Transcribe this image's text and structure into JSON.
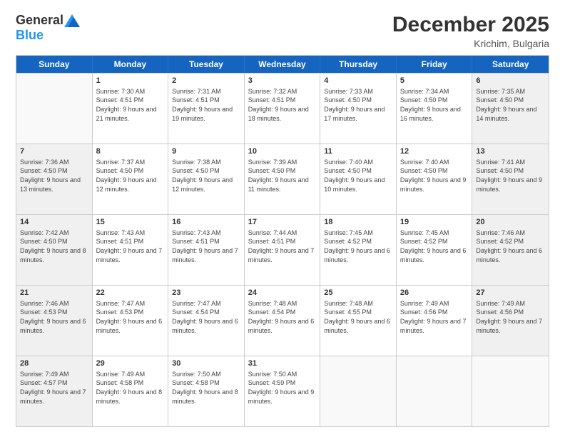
{
  "header": {
    "logo_general": "General",
    "logo_blue": "Blue",
    "month_title": "December 2025",
    "location": "Krichim, Bulgaria"
  },
  "days_of_week": [
    "Sunday",
    "Monday",
    "Tuesday",
    "Wednesday",
    "Thursday",
    "Friday",
    "Saturday"
  ],
  "rows": [
    [
      {
        "day": "",
        "empty": true
      },
      {
        "day": "1",
        "sunrise": "Sunrise: 7:30 AM",
        "sunset": "Sunset: 4:51 PM",
        "daylight": "Daylight: 9 hours and 21 minutes."
      },
      {
        "day": "2",
        "sunrise": "Sunrise: 7:31 AM",
        "sunset": "Sunset: 4:51 PM",
        "daylight": "Daylight: 9 hours and 19 minutes."
      },
      {
        "day": "3",
        "sunrise": "Sunrise: 7:32 AM",
        "sunset": "Sunset: 4:51 PM",
        "daylight": "Daylight: 9 hours and 18 minutes."
      },
      {
        "day": "4",
        "sunrise": "Sunrise: 7:33 AM",
        "sunset": "Sunset: 4:50 PM",
        "daylight": "Daylight: 9 hours and 17 minutes."
      },
      {
        "day": "5",
        "sunrise": "Sunrise: 7:34 AM",
        "sunset": "Sunset: 4:50 PM",
        "daylight": "Daylight: 9 hours and 16 minutes."
      },
      {
        "day": "6",
        "sunrise": "Sunrise: 7:35 AM",
        "sunset": "Sunset: 4:50 PM",
        "daylight": "Daylight: 9 hours and 14 minutes."
      }
    ],
    [
      {
        "day": "7",
        "sunrise": "Sunrise: 7:36 AM",
        "sunset": "Sunset: 4:50 PM",
        "daylight": "Daylight: 9 hours and 13 minutes."
      },
      {
        "day": "8",
        "sunrise": "Sunrise: 7:37 AM",
        "sunset": "Sunset: 4:50 PM",
        "daylight": "Daylight: 9 hours and 12 minutes."
      },
      {
        "day": "9",
        "sunrise": "Sunrise: 7:38 AM",
        "sunset": "Sunset: 4:50 PM",
        "daylight": "Daylight: 9 hours and 12 minutes."
      },
      {
        "day": "10",
        "sunrise": "Sunrise: 7:39 AM",
        "sunset": "Sunset: 4:50 PM",
        "daylight": "Daylight: 9 hours and 11 minutes."
      },
      {
        "day": "11",
        "sunrise": "Sunrise: 7:40 AM",
        "sunset": "Sunset: 4:50 PM",
        "daylight": "Daylight: 9 hours and 10 minutes."
      },
      {
        "day": "12",
        "sunrise": "Sunrise: 7:40 AM",
        "sunset": "Sunset: 4:50 PM",
        "daylight": "Daylight: 9 hours and 9 minutes."
      },
      {
        "day": "13",
        "sunrise": "Sunrise: 7:41 AM",
        "sunset": "Sunset: 4:50 PM",
        "daylight": "Daylight: 9 hours and 9 minutes."
      }
    ],
    [
      {
        "day": "14",
        "sunrise": "Sunrise: 7:42 AM",
        "sunset": "Sunset: 4:50 PM",
        "daylight": "Daylight: 9 hours and 8 minutes."
      },
      {
        "day": "15",
        "sunrise": "Sunrise: 7:43 AM",
        "sunset": "Sunset: 4:51 PM",
        "daylight": "Daylight: 9 hours and 7 minutes."
      },
      {
        "day": "16",
        "sunrise": "Sunrise: 7:43 AM",
        "sunset": "Sunset: 4:51 PM",
        "daylight": "Daylight: 9 hours and 7 minutes."
      },
      {
        "day": "17",
        "sunrise": "Sunrise: 7:44 AM",
        "sunset": "Sunset: 4:51 PM",
        "daylight": "Daylight: 9 hours and 7 minutes."
      },
      {
        "day": "18",
        "sunrise": "Sunrise: 7:45 AM",
        "sunset": "Sunset: 4:52 PM",
        "daylight": "Daylight: 9 hours and 6 minutes."
      },
      {
        "day": "19",
        "sunrise": "Sunrise: 7:45 AM",
        "sunset": "Sunset: 4:52 PM",
        "daylight": "Daylight: 9 hours and 6 minutes."
      },
      {
        "day": "20",
        "sunrise": "Sunrise: 7:46 AM",
        "sunset": "Sunset: 4:52 PM",
        "daylight": "Daylight: 9 hours and 6 minutes."
      }
    ],
    [
      {
        "day": "21",
        "sunrise": "Sunrise: 7:46 AM",
        "sunset": "Sunset: 4:53 PM",
        "daylight": "Daylight: 9 hours and 6 minutes."
      },
      {
        "day": "22",
        "sunrise": "Sunrise: 7:47 AM",
        "sunset": "Sunset: 4:53 PM",
        "daylight": "Daylight: 9 hours and 6 minutes."
      },
      {
        "day": "23",
        "sunrise": "Sunrise: 7:47 AM",
        "sunset": "Sunset: 4:54 PM",
        "daylight": "Daylight: 9 hours and 6 minutes."
      },
      {
        "day": "24",
        "sunrise": "Sunrise: 7:48 AM",
        "sunset": "Sunset: 4:54 PM",
        "daylight": "Daylight: 9 hours and 6 minutes."
      },
      {
        "day": "25",
        "sunrise": "Sunrise: 7:48 AM",
        "sunset": "Sunset: 4:55 PM",
        "daylight": "Daylight: 9 hours and 6 minutes."
      },
      {
        "day": "26",
        "sunrise": "Sunrise: 7:49 AM",
        "sunset": "Sunset: 4:56 PM",
        "daylight": "Daylight: 9 hours and 7 minutes."
      },
      {
        "day": "27",
        "sunrise": "Sunrise: 7:49 AM",
        "sunset": "Sunset: 4:56 PM",
        "daylight": "Daylight: 9 hours and 7 minutes."
      }
    ],
    [
      {
        "day": "28",
        "sunrise": "Sunrise: 7:49 AM",
        "sunset": "Sunset: 4:57 PM",
        "daylight": "Daylight: 9 hours and 7 minutes."
      },
      {
        "day": "29",
        "sunrise": "Sunrise: 7:49 AM",
        "sunset": "Sunset: 4:58 PM",
        "daylight": "Daylight: 9 hours and 8 minutes."
      },
      {
        "day": "30",
        "sunrise": "Sunrise: 7:50 AM",
        "sunset": "Sunset: 4:58 PM",
        "daylight": "Daylight: 9 hours and 8 minutes."
      },
      {
        "day": "31",
        "sunrise": "Sunrise: 7:50 AM",
        "sunset": "Sunset: 4:59 PM",
        "daylight": "Daylight: 9 hours and 9 minutes."
      },
      {
        "day": "",
        "empty": true
      },
      {
        "day": "",
        "empty": true
      },
      {
        "day": "",
        "empty": true
      }
    ]
  ]
}
